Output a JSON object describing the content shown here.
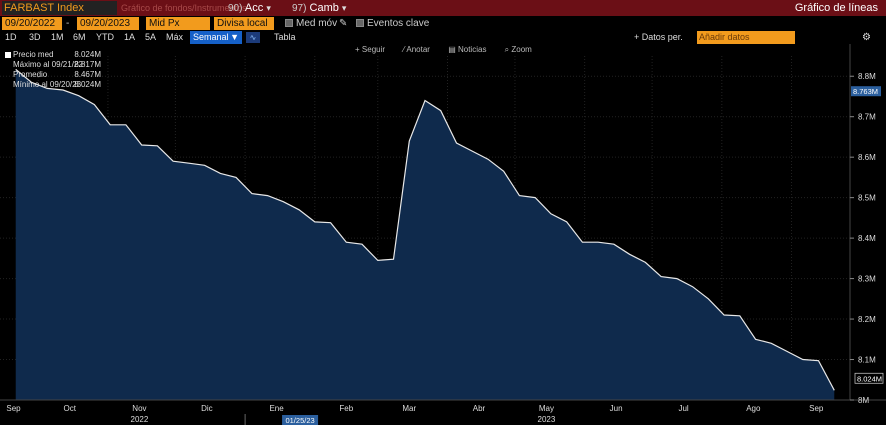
{
  "titlebar": {
    "ticker": "FARBAST Index",
    "ticker_suggest": "Gráfico de fondos/Instrumentos",
    "acc_num": "90)",
    "acc_label": "Acc",
    "camb_num": "97)",
    "camb_label": "Camb",
    "chart_title": "Gráfico de líneas"
  },
  "controls": {
    "start_date": "09/20/2022",
    "end_date": "09/20/2023",
    "field": "Mid Px",
    "currency": "Divisa local",
    "med_mov_label": "Med móv",
    "eventos_label": "Eventos clave"
  },
  "periods": {
    "items": [
      "1D",
      "3D",
      "1M",
      "6M",
      "YTD",
      "1A",
      "5A",
      "Máx"
    ],
    "selected": "Semanal",
    "tabla": "Tabla",
    "datos_label": "+ Datos per.",
    "datos_placeholder": "Añadir datos"
  },
  "toolbar": {
    "seguir": "Seguir",
    "anotar": "Anotar",
    "noticias": "Noticias",
    "zoom": "Zoom"
  },
  "legend": {
    "series": "Precio med",
    "series_value": "8.024M",
    "max_label": "Máximo al 09/21/22",
    "max_value": "8.817M",
    "avg_label": "Promedio",
    "avg_value": "8.467M",
    "min_label": "Mínimo al 09/20/23",
    "min_value": "8.024M"
  },
  "colors": {
    "titlebar_bg": "#6b0f16",
    "accent_orange": "#f29b1d",
    "selected_blue": "#1560c8",
    "area_fill": "#0f2a4c",
    "line": "#e8e8e8",
    "last_price_label": "#2b5f9e"
  },
  "chart_data": {
    "type": "area",
    "x_axis_months": [
      "Sep",
      "Oct",
      "Nov",
      "Dic",
      "Ene",
      "Feb",
      "Mar",
      "Abr",
      "May",
      "Jun",
      "Jul",
      "Ago",
      "Sep"
    ],
    "x_axis_years": [
      "2022",
      "2023"
    ],
    "cursor_date": "01/25/23",
    "y_ticks": [
      "8M",
      "8.1M",
      "8.2M",
      "8.3M",
      "8.4M",
      "8.5M",
      "8.6M",
      "8.7M",
      "8.8M"
    ],
    "ylim": [
      8.0,
      8.85
    ],
    "y_unit": "M",
    "last_value": "8.024M",
    "crosshair_value": "8.763M",
    "crosshair_y": 8.763,
    "series": [
      {
        "name": "Precio med",
        "x": [
          "2022-09-21",
          "2022-09-28",
          "2022-10-05",
          "2022-10-12",
          "2022-10-19",
          "2022-10-26",
          "2022-11-02",
          "2022-11-09",
          "2022-11-16",
          "2022-11-23",
          "2022-11-30",
          "2022-12-07",
          "2022-12-14",
          "2022-12-21",
          "2022-12-28",
          "2023-01-04",
          "2023-01-11",
          "2023-01-18",
          "2023-01-25",
          "2023-02-01",
          "2023-02-08",
          "2023-02-15",
          "2023-02-22",
          "2023-03-01",
          "2023-03-08",
          "2023-03-15",
          "2023-03-22",
          "2023-03-29",
          "2023-04-05",
          "2023-04-12",
          "2023-04-19",
          "2023-04-26",
          "2023-05-03",
          "2023-05-10",
          "2023-05-17",
          "2023-05-24",
          "2023-05-31",
          "2023-06-07",
          "2023-06-14",
          "2023-06-21",
          "2023-06-28",
          "2023-07-05",
          "2023-07-12",
          "2023-07-19",
          "2023-07-26",
          "2023-08-02",
          "2023-08-09",
          "2023-08-16",
          "2023-08-23",
          "2023-08-30",
          "2023-09-06",
          "2023-09-13",
          "2023-09-20"
        ],
        "values": [
          8.817,
          8.785,
          8.77,
          8.766,
          8.752,
          8.73,
          8.68,
          8.68,
          8.63,
          8.628,
          8.59,
          8.585,
          8.58,
          8.56,
          8.55,
          8.51,
          8.505,
          8.49,
          8.47,
          8.44,
          8.438,
          8.39,
          8.385,
          8.345,
          8.348,
          8.64,
          8.74,
          8.715,
          8.635,
          8.615,
          8.595,
          8.565,
          8.505,
          8.5,
          8.46,
          8.44,
          8.39,
          8.39,
          8.385,
          8.36,
          8.34,
          8.305,
          8.3,
          8.28,
          8.25,
          8.21,
          8.208,
          8.15,
          8.14,
          8.12,
          8.1,
          8.097,
          8.024
        ]
      }
    ]
  }
}
